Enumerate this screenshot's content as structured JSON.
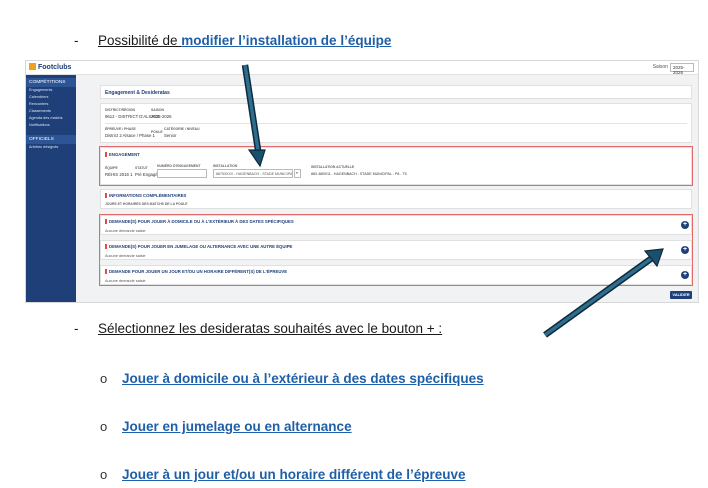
{
  "bullet_top": {
    "dash": "-",
    "prefix": "Possibilité de ",
    "link": "modifier l’installation de l’équipe"
  },
  "bullet_bottom": {
    "dash": "-",
    "text": "Sélectionnez les desideratas souhaités avec le bouton + :"
  },
  "sub_bullets": [
    {
      "marker": "o",
      "text": "Jouer à domicile ou à l’extérieur à des dates spécifiques"
    },
    {
      "marker": "o",
      "text": "Jouer en jumelage ou en alternance"
    },
    {
      "marker": "o",
      "text": "Jouer à un jour et/ou un horaire différent de l’épreuve"
    }
  ],
  "app": {
    "logo": "Footclubs",
    "saison_label": "Saison",
    "saison_value": "2025-2026",
    "sidebar": {
      "section1": "COMPÉTITIONS",
      "items1": [
        "Engagements",
        "Calendriers",
        "Rencontres",
        "Classements",
        "Agenda des matchs",
        "Notifications"
      ],
      "section2": "OFFICIELS",
      "items2": [
        "Arbitres désignés"
      ]
    },
    "page_title": "Engagement & Desideratas",
    "info": {
      "label_district": "DISTRICT/RÉGION",
      "value_district": "9612 - DISTRICT D'ALSACE",
      "label_saison": "SAISON",
      "value_saison": "2025-2026",
      "label_epreuve": "ÉPREUVE / PHASE",
      "value_epreuve": "District 2 Alsace / Phase 1",
      "label_cat": "CATÉGORIE / NIVEAU",
      "value_cat": "Senior",
      "label_pool": "POULE"
    },
    "engagement": {
      "title": "ENGAGEMENT",
      "label_equipe": "ÉQUIPE",
      "value_equipe": "RÉHIS 2016 1",
      "label_statut": "STATUT",
      "value_statut": "Pré Engagée",
      "label_num": "NUMÉRO D'ENGAGEMENT",
      "label_install": "INSTALLATION",
      "value_install": "88753XXX - HAGENBACH - STADE MUNICIPAL - P8 - T5",
      "label_install_actuelle": "INSTALLATION ACTUELLE",
      "value_install_actuelle": "88X-889X11 - HAGENBACH - STADE MUNICIPAL - P8 - T5"
    },
    "infos_comp": {
      "title": "INFORMATIONS COMPLÉMENTAIRES",
      "subtitle": "JOURS ET HORAIRES DES MATCHS DE LA POULE"
    },
    "desiderata": [
      {
        "title": "DEMANDE(S) POUR JOUER À DOMICILE OU À L'EXTÉRIEUR À DES DATES SPÉCIFIQUES",
        "empty": "Aucune demande saisie"
      },
      {
        "title": "DEMANDE(S) POUR JOUER EN JUMELAGE OU ALTERNANCE AVEC UNE AUTRE ÉQUIPE",
        "empty": "Aucune demande saisie"
      },
      {
        "title": "DEMANDE POUR JOUER UN JOUR ET/OU UN HORAIRE DIFFÉRENT(S) DE L'ÉPREUVE",
        "empty": "Aucune demande saisie"
      }
    ],
    "plus_label": "+",
    "valider_label": "VALIDER"
  },
  "colors": {
    "brand_blue": "#1e3f78",
    "link_blue": "#1f5fa8",
    "highlight_red": "#e26a6a",
    "arrow_teal": "#1b4f6e"
  }
}
